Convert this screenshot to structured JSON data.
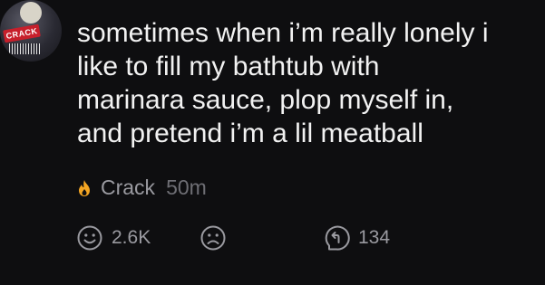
{
  "post": {
    "text": "sometimes when i’m really lonely i\nlike to fill my bathtub with\nmarinara sauce, plop myself in,\nand pretend i’m a lil meatball",
    "author": "Crack",
    "age": "50m",
    "avatar_badge": "CRACK"
  },
  "actions": {
    "upvote_count": "2.6K",
    "reply_count": "134"
  },
  "icons": {
    "flame": "flame-icon",
    "smile": "smile-face-icon",
    "frown": "frown-face-icon",
    "reply": "reply-arrow-icon"
  },
  "colors": {
    "background": "#0e0e10",
    "text": "#f2f2f2",
    "muted": "#9a9aa0",
    "flame": "#f5a623"
  }
}
